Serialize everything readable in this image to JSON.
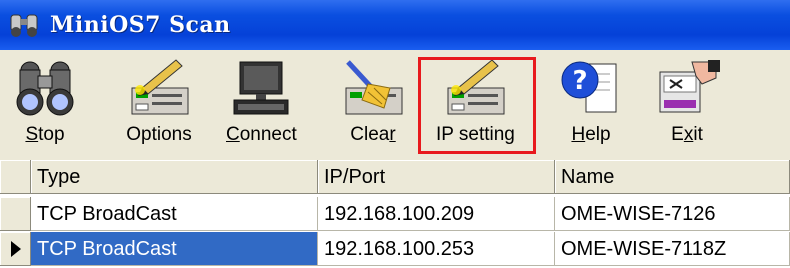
{
  "window": {
    "title": "MiniOS7 Scan",
    "icon": "binoculars-icon"
  },
  "toolbar": {
    "buttons": [
      {
        "key": "S",
        "rest": "top",
        "icon": "binoculars-icon"
      },
      {
        "label": "Options",
        "icon": "options-pencil-icon"
      },
      {
        "key": "C",
        "rest": "onnect",
        "icon": "computer-icon"
      },
      {
        "pre": "Clea",
        "key": "r",
        "icon": "broom-clear-icon"
      },
      {
        "label": "IP setting",
        "icon": "ip-setting-pencil-icon",
        "highlighted": true
      },
      {
        "key": "H",
        "rest": "elp",
        "icon": "help-icon"
      },
      {
        "pre": "E",
        "key": "x",
        "rest": "it",
        "icon": "exit-icon"
      }
    ],
    "highlight_color": "#e8191d"
  },
  "table": {
    "columns": [
      "Type",
      "IP/Port",
      "Name"
    ],
    "rows": [
      {
        "type": "TCP BroadCast",
        "ip": "192.168.100.209",
        "name": "OME-WISE-7126"
      },
      {
        "type": "TCP BroadCast",
        "ip": "192.168.100.253",
        "name": "OME-WISE-7118Z",
        "selected": true
      }
    ],
    "selection_color": "#316ac5"
  }
}
